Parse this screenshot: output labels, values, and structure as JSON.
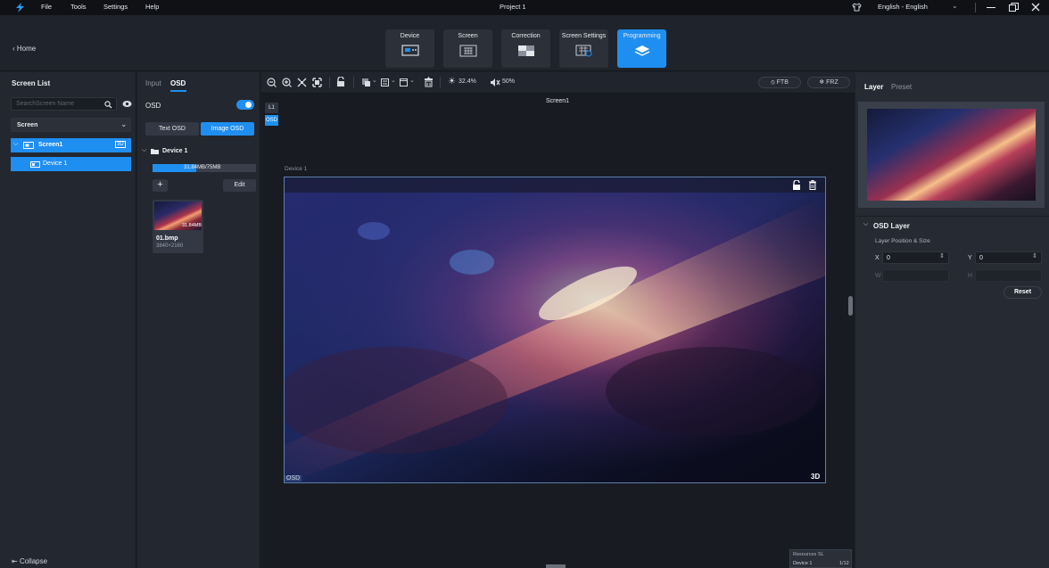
{
  "titlebar": {
    "menu": [
      "File",
      "Tools",
      "Settings",
      "Help"
    ],
    "project": "Project 1",
    "language": "English - English"
  },
  "nav": {
    "home": "Home"
  },
  "modes": [
    {
      "label": "Device"
    },
    {
      "label": "Screen"
    },
    {
      "label": "Correction"
    },
    {
      "label": "Screen Settings"
    },
    {
      "label": "Programming"
    }
  ],
  "left": {
    "title": "Screen List",
    "search_placeholder": "SearchScreen Name",
    "filter": "Screen",
    "screen_name": "Screen1",
    "screen_badge": "3D",
    "device_name": "Device 1",
    "collapse": "Collapse"
  },
  "osdpanel": {
    "tab_input": "Input",
    "tab_osd": "OSD",
    "osd_label": "OSD",
    "text_osd": "Text OSD",
    "image_osd": "Image OSD",
    "device_group": "Device 1",
    "capacity": "31.84MB/75MB",
    "edit": "Edit",
    "file_name": "01.bmp",
    "file_res": "3840×2160",
    "file_size": "31.84MB"
  },
  "canvas": {
    "zoom_text": "32.4%",
    "opacity_text": "50%",
    "ftb": "FTB",
    "frz": "FRZ",
    "layer_tag": "L1",
    "osd_tag": "OSD",
    "screen_title": "Screen1",
    "device_label": "Device 1",
    "osd_corner": "OSD",
    "badge3d": "3D",
    "resources_title": "Resources SL",
    "resources_device": "Device 1",
    "resources_count": "1/12"
  },
  "right": {
    "tab_layer": "Layer",
    "tab_preset": "Preset",
    "section": "OSD Layer",
    "pos_size": "Layer Position & Size",
    "x_label": "X",
    "x_val": "0",
    "y_label": "Y",
    "y_val": "0",
    "w_label": "W",
    "h_label": "H",
    "reset": "Reset"
  },
  "colors": {
    "accent": "#1f8ef1"
  }
}
